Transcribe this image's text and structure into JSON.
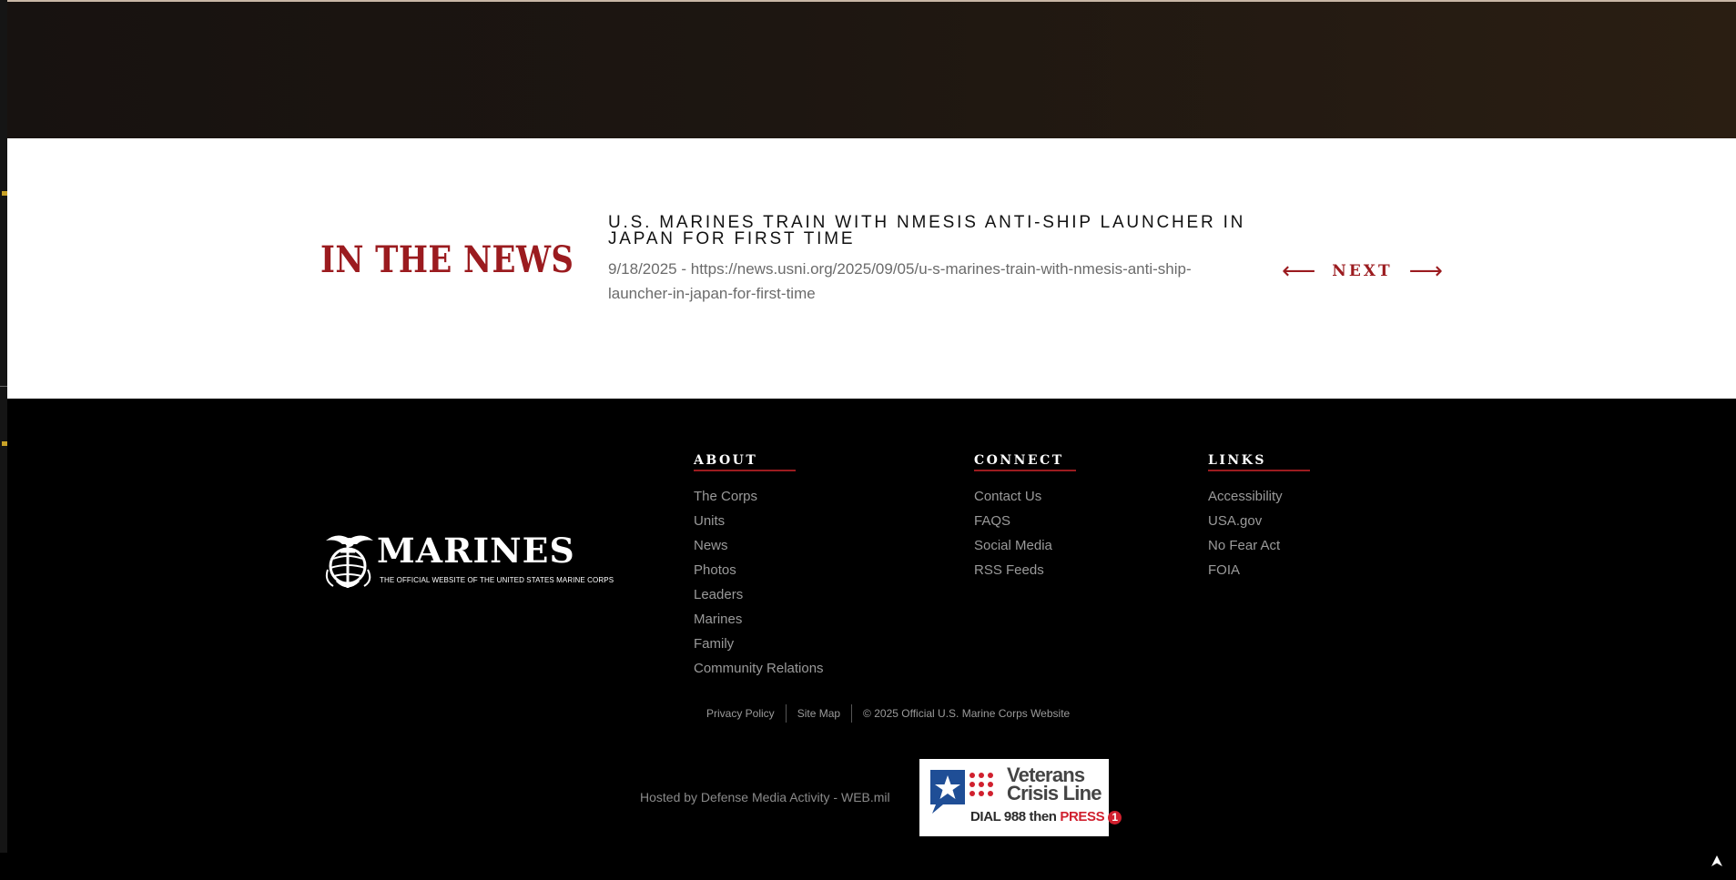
{
  "news": {
    "heading": "IN THE NEWS",
    "title": "U.S. MARINES TRAIN WITH NMESIS ANTI-SHIP LAUNCHER IN JAPAN FOR FIRST TIME",
    "date": "9/18/2025",
    "source_url": "https://news.usni.org/2025/09/05/u-s-marines-train-with-nmesis-anti-ship-launcher-in-japan-for-first-time",
    "separator": " - ",
    "next_label": "NEXT",
    "prev_icon": "arrow-left-icon",
    "next_icon": "arrow-right-icon"
  },
  "footer": {
    "logo": {
      "wordmark": "MARINES",
      "tagline": "THE OFFICIAL WEBSITE OF THE UNITED STATES MARINE CORPS",
      "emblem_icon": "eagle-globe-anchor-icon"
    },
    "columns": [
      {
        "heading": "ABOUT",
        "items": [
          "The Corps",
          "Units",
          "News",
          "Photos",
          "Leaders",
          "Marines",
          "Family",
          "Community Relations"
        ]
      },
      {
        "heading": "CONNECT",
        "items": [
          "Contact Us",
          "FAQS",
          "Social Media",
          "RSS Feeds"
        ]
      },
      {
        "heading": "LINKS",
        "items": [
          "Accessibility",
          "USA.gov",
          "No Fear Act",
          "FOIA"
        ]
      }
    ],
    "legal": {
      "privacy": "Privacy Policy",
      "sitemap": "Site Map",
      "copyright": "© 2025 Official U.S. Marine Corps Website"
    },
    "hosted": "Hosted by Defense Media Activity - WEB.mil",
    "crisis_line": {
      "title": "Veterans Crisis Line",
      "dial": "DIAL 988 then",
      "press": "PRESS",
      "press_number": "1",
      "icon": "star-speech-bubble-icon"
    }
  },
  "colors": {
    "accent_red": "#9b1b1f",
    "footer_bg": "#000000",
    "news_bg": "#ffffff",
    "link_gray": "#9a9a9a",
    "rail_gold": "#c9a227",
    "vcl_blue": "#1f4e96",
    "vcl_red": "#d0202e"
  },
  "scroll_top_icon": "arrow-up-icon"
}
